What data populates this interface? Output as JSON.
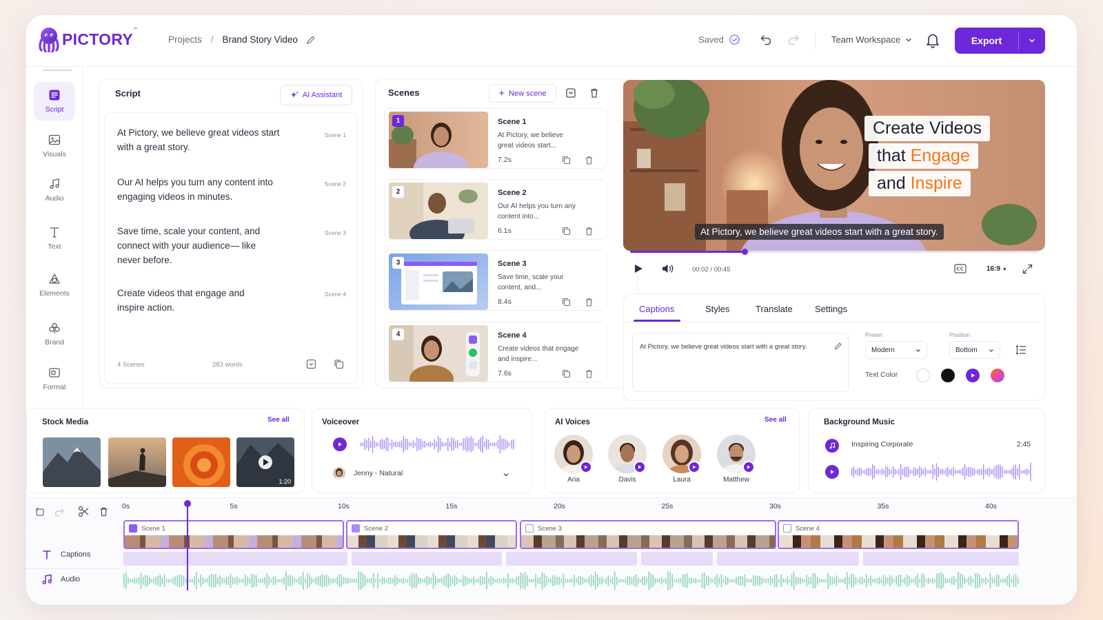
{
  "brand": {
    "name": "PICTORY",
    "tm": "™",
    "accent": "#6d28d9",
    "orange": "#f97316"
  },
  "header": {
    "breadcrumb_root": "Projects",
    "breadcrumb_sep": "/",
    "breadcrumb_current": "Brand Story Video",
    "saved_label": "Saved",
    "workspace_label": "Team Workspace",
    "export_label": "Export"
  },
  "sidebar": {
    "items": [
      {
        "label": "Script",
        "icon": "script-icon",
        "active": true
      },
      {
        "label": "Visuals",
        "icon": "image-icon"
      },
      {
        "label": "Audio",
        "icon": "music-icon"
      },
      {
        "label": "Text",
        "icon": "text-icon"
      },
      {
        "label": "Elements",
        "icon": "shapes-icon"
      },
      {
        "label": "Brand",
        "icon": "brand-icon"
      },
      {
        "label": "Format",
        "icon": "format-icon"
      }
    ]
  },
  "script": {
    "title": "Script",
    "ai_button": "AI Assistant",
    "paragraphs": [
      {
        "text": "At Pictory, we believe great videos start with a great story.",
        "tag": "Scene 1"
      },
      {
        "text": "Our AI helps you turn any content into engaging videos in minutes.",
        "tag": "Scene 2"
      },
      {
        "text": "Save time, scale your content, and connect with your audience— like never before.",
        "tag": "Scene 3"
      },
      {
        "text": "Create videos that engage and inspire action.",
        "tag": "Scene 4"
      }
    ],
    "scene_count": "4 Scenes",
    "word_count": "283 words"
  },
  "scenes": {
    "title": "Scenes",
    "new_button": "New scene",
    "items": [
      {
        "num": "1",
        "name": "Scene 1",
        "desc": "At Pictory, we believe great videos start...",
        "dur": "7.2s"
      },
      {
        "num": "2",
        "name": "Scene 2",
        "desc": "Our AI helps you turn any content into...",
        "dur": "6.1s"
      },
      {
        "num": "3",
        "name": "Scene 3",
        "desc": "Save time, scale your content, and...",
        "dur": "8.4s"
      },
      {
        "num": "4",
        "name": "Scene 4",
        "desc": "Create videos that engage and inspire...",
        "dur": "7.6s"
      }
    ]
  },
  "preview": {
    "title_lines": [
      {
        "pre": "Create Videos",
        "hl": ""
      },
      {
        "pre": "that ",
        "hl": "Engage"
      },
      {
        "pre": "and ",
        "hl": "Inspire"
      }
    ],
    "subtitle": "At Pictory, we believe great videos start with a great story.",
    "time": "00:02 / 00:45",
    "progress": 0.28,
    "aspect": "16:9"
  },
  "caption_editor": {
    "tabs": [
      "Captions",
      "Styles",
      "Translate",
      "Settings"
    ],
    "active_tab": "Captions",
    "text": "At Pictory, we believe great videos start with a great story.",
    "preset_label": "Preset",
    "preset_value": "Modern",
    "position_label": "Position",
    "position_value": "Bottom",
    "text_color_label": "Text Color",
    "swatches": [
      "#ffffff",
      "#111111",
      "#6d28d9",
      "gradient"
    ]
  },
  "stock_media": {
    "title": "Stock Media",
    "see_all": "See all",
    "video_duration": "1:20"
  },
  "voiceover": {
    "title": "Voiceover",
    "voice": "Jenny - Natural"
  },
  "ai_voices": {
    "title": "AI Voices",
    "see_all": "See all",
    "voices": [
      "Aria",
      "Davis",
      "Laura",
      "Matthew"
    ]
  },
  "background_music": {
    "title": "Background Music",
    "track": "Inspiring Corporate",
    "duration": "2:45"
  },
  "timeline": {
    "ticks": [
      "0s",
      "5s",
      "10s",
      "15s",
      "20s",
      "25s",
      "30s",
      "35s",
      "40s"
    ],
    "clips": [
      "Scene 1",
      "Scene 2",
      "Scene 3",
      "Scene 4"
    ],
    "tracks": [
      "Captions",
      "Audio"
    ],
    "playhead_seconds": 3
  }
}
